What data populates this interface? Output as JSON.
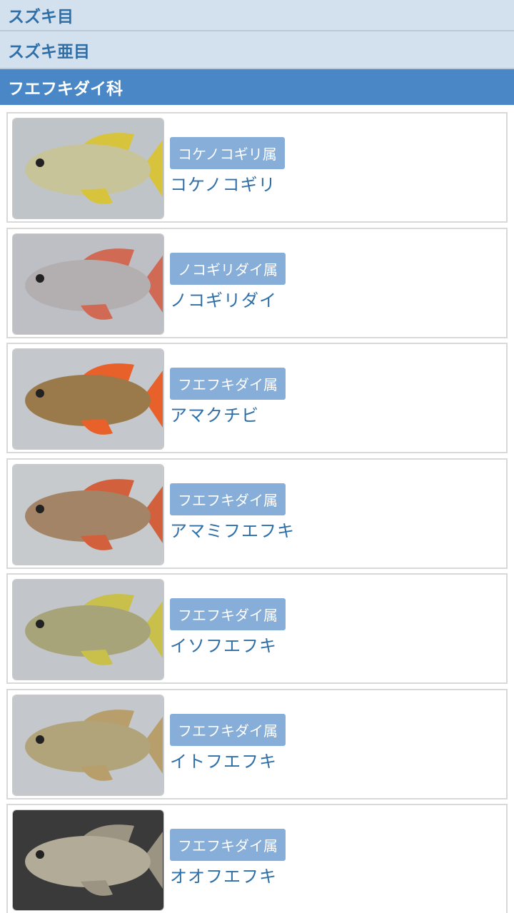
{
  "header": {
    "order": "スズキ目",
    "suborder": "スズキ亜目",
    "family": "フエフキダイ科"
  },
  "species": [
    {
      "genus": "コケノコギリ属",
      "name": "コケノコギリ",
      "body_color": "#c8c49a",
      "fin_color": "#d8c43c",
      "background": "#bfc4c8"
    },
    {
      "genus": "ノコギリダイ属",
      "name": "ノコギリダイ",
      "body_color": "#b3afb0",
      "fin_color": "#d06a55",
      "background": "#bdbfc4"
    },
    {
      "genus": "フエフキダイ属",
      "name": "アマクチビ",
      "body_color": "#9a7a4a",
      "fin_color": "#e8602a",
      "background": "#c4c8cc"
    },
    {
      "genus": "フエフキダイ属",
      "name": "アマミフエフキ",
      "body_color": "#a38466",
      "fin_color": "#d2603c",
      "background": "#c6cacd"
    },
    {
      "genus": "フエフキダイ属",
      "name": "イソフエフキ",
      "body_color": "#a8a47a",
      "fin_color": "#c8c04a",
      "background": "#c2c6ca"
    },
    {
      "genus": "フエフキダイ属",
      "name": "イトフエフキ",
      "body_color": "#b1a47a",
      "fin_color": "#b89e6a",
      "background": "#c4c8cc"
    },
    {
      "genus": "フエフキダイ属",
      "name": "オオフエフキ",
      "body_color": "#b2ab98",
      "fin_color": "#9b9482",
      "background": "#3a3a3a"
    }
  ]
}
